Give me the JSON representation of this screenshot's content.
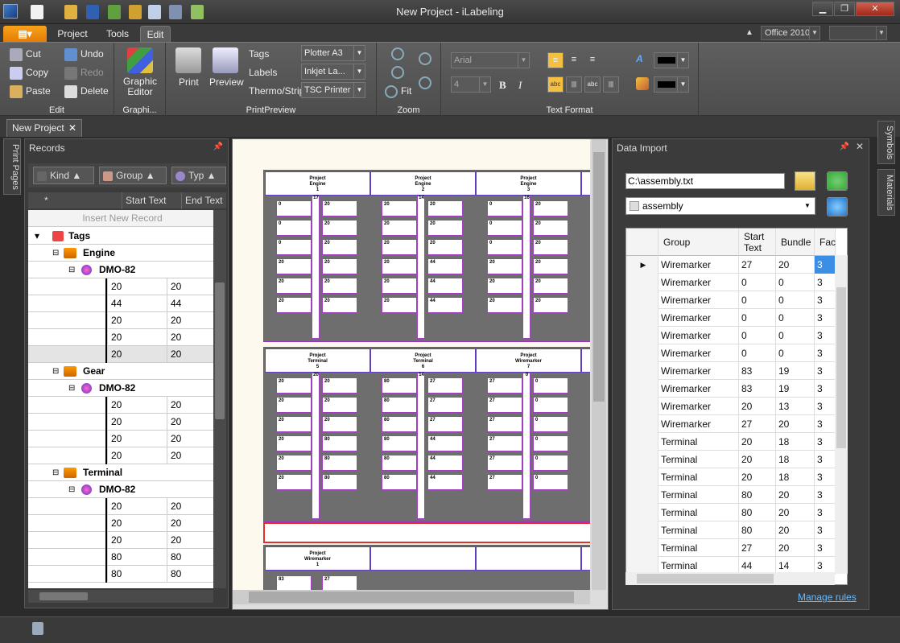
{
  "window": {
    "title": "New Project - iLabeling"
  },
  "menu": {
    "tabs": [
      {
        "label": "Project"
      },
      {
        "label": "Tools"
      },
      {
        "label": "Edit"
      }
    ],
    "theme": "Office 2010"
  },
  "ribbon": {
    "clipboard": {
      "cut": "Cut",
      "copy": "Copy",
      "paste": "Paste",
      "undo": "Undo",
      "redo": "Redo",
      "delete": "Delete",
      "group": "Edit"
    },
    "graphic": {
      "label1": "Graphic",
      "label2": "Editor",
      "group": "Graphi..."
    },
    "print": {
      "print": "Print",
      "preview": "Preview",
      "tags": "Tags",
      "labels": "Labels",
      "thermo": "Thermo/Strip",
      "tags_value": "Plotter A3",
      "labels_value": "Inkjet La...",
      "thermo_value": "TSC Printer",
      "group": "PrintPreview"
    },
    "zoom": {
      "fit": "Fit",
      "group": "Zoom"
    },
    "text": {
      "font": "Arial",
      "size": "4",
      "bold": "B",
      "italic": "I",
      "group": "Text Format"
    }
  },
  "doctab": {
    "label": "New Project"
  },
  "sidetabs": {
    "print_pages": "Print Pages",
    "symbols": "Symbols",
    "materials": "Materials"
  },
  "records": {
    "title": "Records",
    "groupby": [
      "Kind",
      "Group",
      "Typ"
    ],
    "columns": {
      "star": "*",
      "start": "Start Text",
      "end": "End Text"
    },
    "insert": "Insert New Record",
    "root": "Tags",
    "groups": [
      {
        "name": "Engine",
        "type": "DMO-82",
        "rows": [
          [
            "20",
            "20"
          ],
          [
            "44",
            "44"
          ],
          [
            "20",
            "20"
          ],
          [
            "20",
            "20"
          ],
          [
            "20",
            "20"
          ]
        ]
      },
      {
        "name": "Gear",
        "type": "DMO-82",
        "rows": [
          [
            "20",
            "20"
          ],
          [
            "20",
            "20"
          ],
          [
            "20",
            "20"
          ],
          [
            "20",
            "20"
          ]
        ]
      },
      {
        "name": "Terminal",
        "type": "DMO-82",
        "rows": [
          [
            "20",
            "20"
          ],
          [
            "20",
            "20"
          ],
          [
            "20",
            "20"
          ],
          [
            "80",
            "80"
          ],
          [
            "80",
            "80"
          ]
        ]
      }
    ]
  },
  "preview": {
    "cols_row1": [
      {
        "t1": "Project",
        "t2": "Engine",
        "n": "1",
        "top": "17"
      },
      {
        "t1": "Project",
        "t2": "Engine",
        "n": "2",
        "top": "14"
      },
      {
        "t1": "Project",
        "t2": "Engine",
        "n": "3",
        "top": "16"
      }
    ],
    "cols_row2": [
      {
        "t1": "Project",
        "t2": "Terminal",
        "n": "5",
        "top": "20"
      },
      {
        "t1": "Project",
        "t2": "Terminal",
        "n": "6",
        "top": "14"
      },
      {
        "t1": "Project",
        "t2": "Wiremarker",
        "n": "7",
        "top": "0"
      }
    ],
    "cols_row3": [
      {
        "t1": "Project",
        "t2": "Wiremarker",
        "n": "1",
        "top": "20"
      }
    ],
    "labels_row1": [
      [
        "0",
        "20",
        "20",
        "20"
      ],
      [
        "0",
        "20",
        "20",
        "20"
      ],
      [
        "0",
        "20",
        "20",
        "20"
      ],
      [
        "20",
        "20",
        "20",
        "44"
      ],
      [
        "20",
        "20",
        "20",
        "44"
      ],
      [
        "20",
        "20",
        "20",
        "44"
      ]
    ],
    "labels_row2": [
      [
        "20",
        "20",
        "80",
        "27"
      ],
      [
        "20",
        "20",
        "80",
        "27"
      ],
      [
        "20",
        "20",
        "80",
        "27"
      ],
      [
        "20",
        "80",
        "80",
        "44"
      ],
      [
        "20",
        "80",
        "80",
        "44"
      ],
      [
        "20",
        "80",
        "80",
        "44"
      ]
    ],
    "labels_row2c": [
      [
        "27",
        "0"
      ],
      [
        "27",
        "0"
      ],
      [
        "27",
        "0"
      ],
      [
        "27",
        "0"
      ],
      [
        "27",
        "0"
      ],
      [
        "27",
        "0"
      ]
    ],
    "labels_row3": [
      [
        "83",
        "27"
      ]
    ]
  },
  "import": {
    "title": "Data Import",
    "path": "C:\\assembly.txt",
    "table": "assembly",
    "columns": {
      "group": "Group",
      "start": "Start Text",
      "bundle": "Bundle",
      "fac": "Fac"
    },
    "rows": [
      [
        "Wiremarker",
        "27",
        "20",
        "3"
      ],
      [
        "Wiremarker",
        "0",
        "0",
        "3"
      ],
      [
        "Wiremarker",
        "0",
        "0",
        "3"
      ],
      [
        "Wiremarker",
        "0",
        "0",
        "3"
      ],
      [
        "Wiremarker",
        "0",
        "0",
        "3"
      ],
      [
        "Wiremarker",
        "0",
        "0",
        "3"
      ],
      [
        "Wiremarker",
        "83",
        "19",
        "3"
      ],
      [
        "Wiremarker",
        "83",
        "19",
        "3"
      ],
      [
        "Wiremarker",
        "20",
        "13",
        "3"
      ],
      [
        "Wiremarker",
        "27",
        "20",
        "3"
      ],
      [
        "Terminal",
        "20",
        "18",
        "3"
      ],
      [
        "Terminal",
        "20",
        "18",
        "3"
      ],
      [
        "Terminal",
        "20",
        "18",
        "3"
      ],
      [
        "Terminal",
        "80",
        "20",
        "3"
      ],
      [
        "Terminal",
        "80",
        "20",
        "3"
      ],
      [
        "Terminal",
        "80",
        "20",
        "3"
      ],
      [
        "Terminal",
        "27",
        "20",
        "3"
      ],
      [
        "Terminal",
        "44",
        "14",
        "3"
      ]
    ],
    "manage": "Manage rules"
  }
}
